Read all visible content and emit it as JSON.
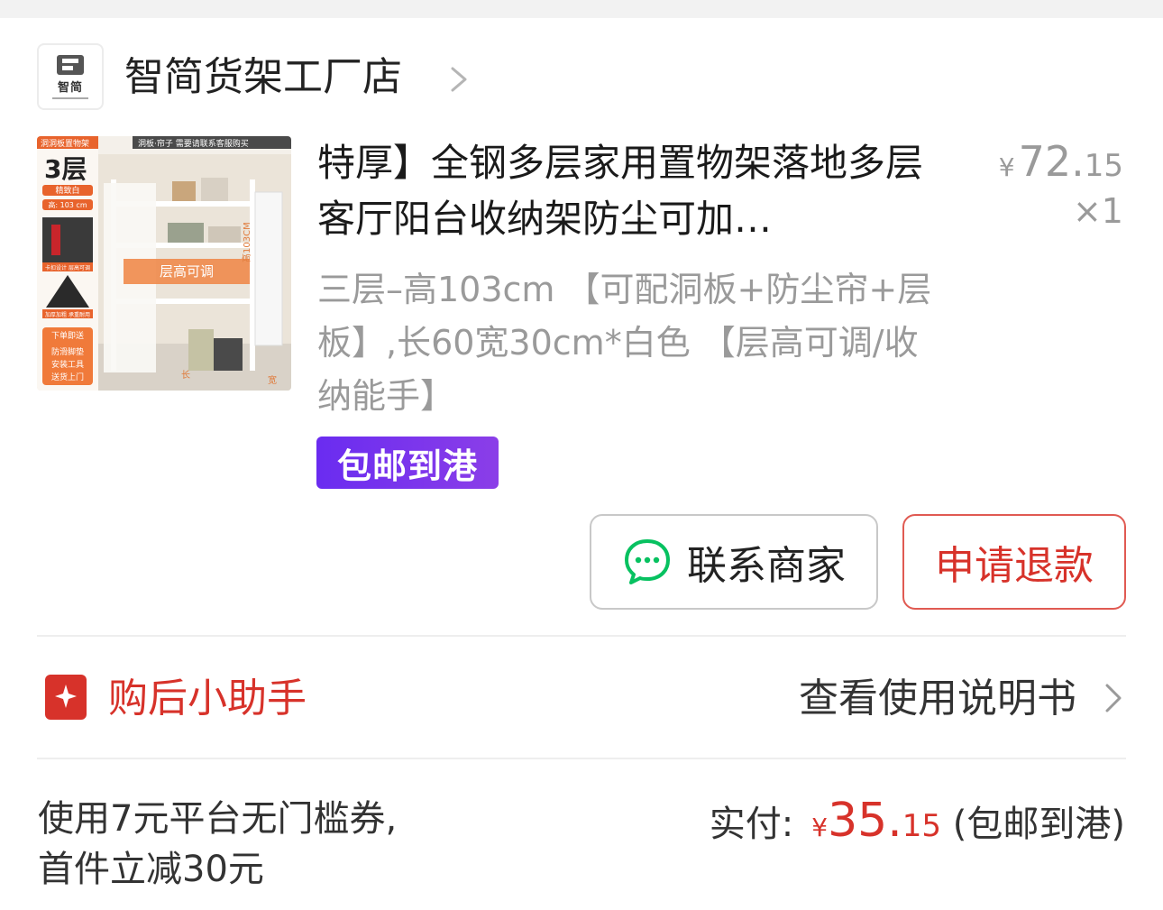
{
  "store": {
    "logo_text": "智简",
    "name": "智简货架工厂店"
  },
  "product": {
    "title": "特厚】全钢多层家用置物架落地多层客厅阳台收纳架防尘可加…",
    "price_currency": "¥",
    "price_int": "72.",
    "price_dec": "15",
    "quantity": "×1",
    "spec": "三层–高103cm 【可配洞板+防尘帘+层板】,长60宽30cm*白色 【层高可调/收纳能手】",
    "shipping_badge": "包邮到港",
    "image": {
      "banner_left": "洞洞板置物架",
      "banner_right": "洞板·帘子 需要请联系客服购买",
      "tier_label": "3层",
      "color_tag": "精致白",
      "height_tag": "高: 103 cm",
      "center_label": "层高可调",
      "detail_caption_1": "卡扣设计 层高可调",
      "detail_caption_2": "加厚加粗 承重耐用",
      "gift_title": "下单即送",
      "gift_items": [
        "防滑脚垫",
        "安装工具",
        "送货上门"
      ],
      "dim_width": "长",
      "dim_depth": "宽",
      "dim_height": "高103CM"
    }
  },
  "actions": {
    "contact_label": "联系商家",
    "refund_label": "申请退款"
  },
  "helper": {
    "label": "购后小助手",
    "manual_link": "查看使用说明书"
  },
  "footer": {
    "coupon_text": "使用7元平台无门槛券, 首件立减30元",
    "paid_label": "实付:",
    "paid_currency": "¥",
    "paid_int": "35.",
    "paid_dec": "15",
    "paid_note": "(包邮到港)"
  },
  "colors": {
    "accent_red": "#d7322a",
    "badge_purple": "#6a2cf0",
    "chat_green": "#07c160",
    "muted_gray": "#9a9a9a"
  }
}
